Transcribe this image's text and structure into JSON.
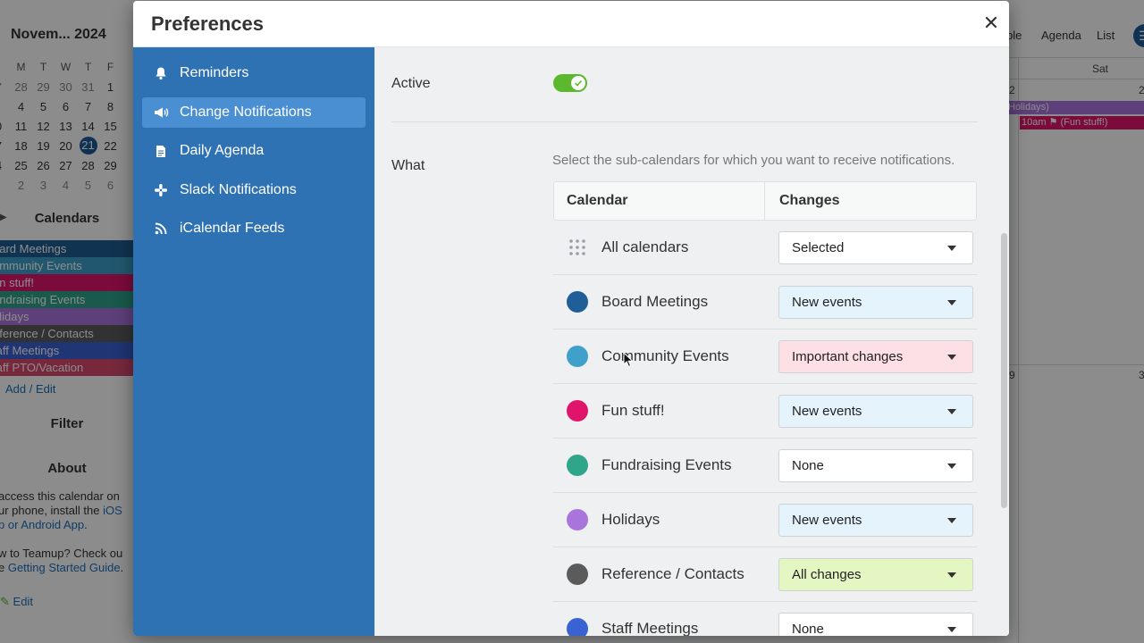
{
  "background": {
    "mini_calendar": {
      "title": "Novem... 2024",
      "weekdays": [
        "M",
        "T",
        "W",
        "T",
        "F"
      ],
      "weeks": [
        [
          "7",
          "28",
          "29",
          "30",
          "31",
          "1"
        ],
        [
          "",
          "4",
          "5",
          "6",
          "7",
          "8"
        ],
        [
          "0",
          "11",
          "12",
          "13",
          "14",
          "15"
        ],
        [
          "7",
          "18",
          "19",
          "20",
          "21",
          "22"
        ],
        [
          "4",
          "25",
          "26",
          "27",
          "28",
          "29"
        ],
        [
          "",
          "2",
          "3",
          "4",
          "5",
          "6"
        ]
      ]
    },
    "calendars_heading": "Calendars",
    "calendars": [
      {
        "label": "oard Meetings",
        "color": "#1f5e96"
      },
      {
        "label": "ommunity Events",
        "color": "#3fa0cb"
      },
      {
        "label": "un stuff!",
        "color": "#e0146a"
      },
      {
        "label": "undraising Events",
        "color": "#2fa58a"
      },
      {
        "label": "olidays",
        "color": "#a974dc"
      },
      {
        "label": "eference / Contacts",
        "color": "#5b5b5b"
      },
      {
        "label": "taff Meetings",
        "color": "#3a62d3"
      },
      {
        "label": "taff PTO/Vacation",
        "color": "#d9496d"
      }
    ],
    "add_edit": "Add / Edit",
    "filter_heading": "Filter",
    "about_heading": "About",
    "about_line1": "access this calendar on",
    "about_line2a": "ur phone, install the ",
    "about_line2_link": "iOS",
    "about_line3_link": "p or Android App",
    "about_line4": "w to Teamup? Check ou",
    "about_line5a": "e ",
    "about_line5_link": "Getting Started Guide",
    "edit_link": "Edit",
    "view_tabs": [
      "ble",
      "Agenda",
      "List"
    ],
    "saturday": "Sat",
    "event_1": "Holidays)",
    "event_2": "10am ⚑ (Fun stuff!)",
    "day_nums": [
      "2",
      "2",
      "9",
      "3"
    ]
  },
  "modal": {
    "title": "Preferences",
    "close_glyph": "✕",
    "nav": [
      {
        "label": "Reminders",
        "icon": "bell-icon",
        "active": false
      },
      {
        "label": "Change Notifications",
        "icon": "megaphone-icon",
        "active": true
      },
      {
        "label": "Daily Agenda",
        "icon": "document-icon",
        "active": false
      },
      {
        "label": "Slack Notifications",
        "icon": "slack-icon",
        "active": false
      },
      {
        "label": "iCalendar Feeds",
        "icon": "rss-icon",
        "active": false
      }
    ],
    "active_label": "Active",
    "active_on": true,
    "what_label": "What",
    "what_description": "Select the sub-calendars for which you want to receive notifications.",
    "table": {
      "col_calendar": "Calendar",
      "col_changes": "Changes",
      "rows": [
        {
          "name": "All calendars",
          "color": "",
          "value": "Selected",
          "bg": "#ffffff"
        },
        {
          "name": "Board Meetings",
          "color": "#1f5e96",
          "value": "New events",
          "bg": "#e4f3fc"
        },
        {
          "name": "Community Events",
          "color": "#3fa0cb",
          "value": "Important changes",
          "bg": "#fde0e6"
        },
        {
          "name": "Fun stuff!",
          "color": "#e0146a",
          "value": "New events",
          "bg": "#e4f3fc"
        },
        {
          "name": "Fundraising Events",
          "color": "#2fa58a",
          "value": "None",
          "bg": "#ffffff"
        },
        {
          "name": "Holidays",
          "color": "#a974dc",
          "value": "New events",
          "bg": "#e4f3fc"
        },
        {
          "name": "Reference / Contacts",
          "color": "#5b5b5b",
          "value": "All changes",
          "bg": "#e4f7c3"
        },
        {
          "name": "Staff Meetings",
          "color": "#3a62d3",
          "value": "None",
          "bg": "#ffffff"
        }
      ]
    }
  }
}
